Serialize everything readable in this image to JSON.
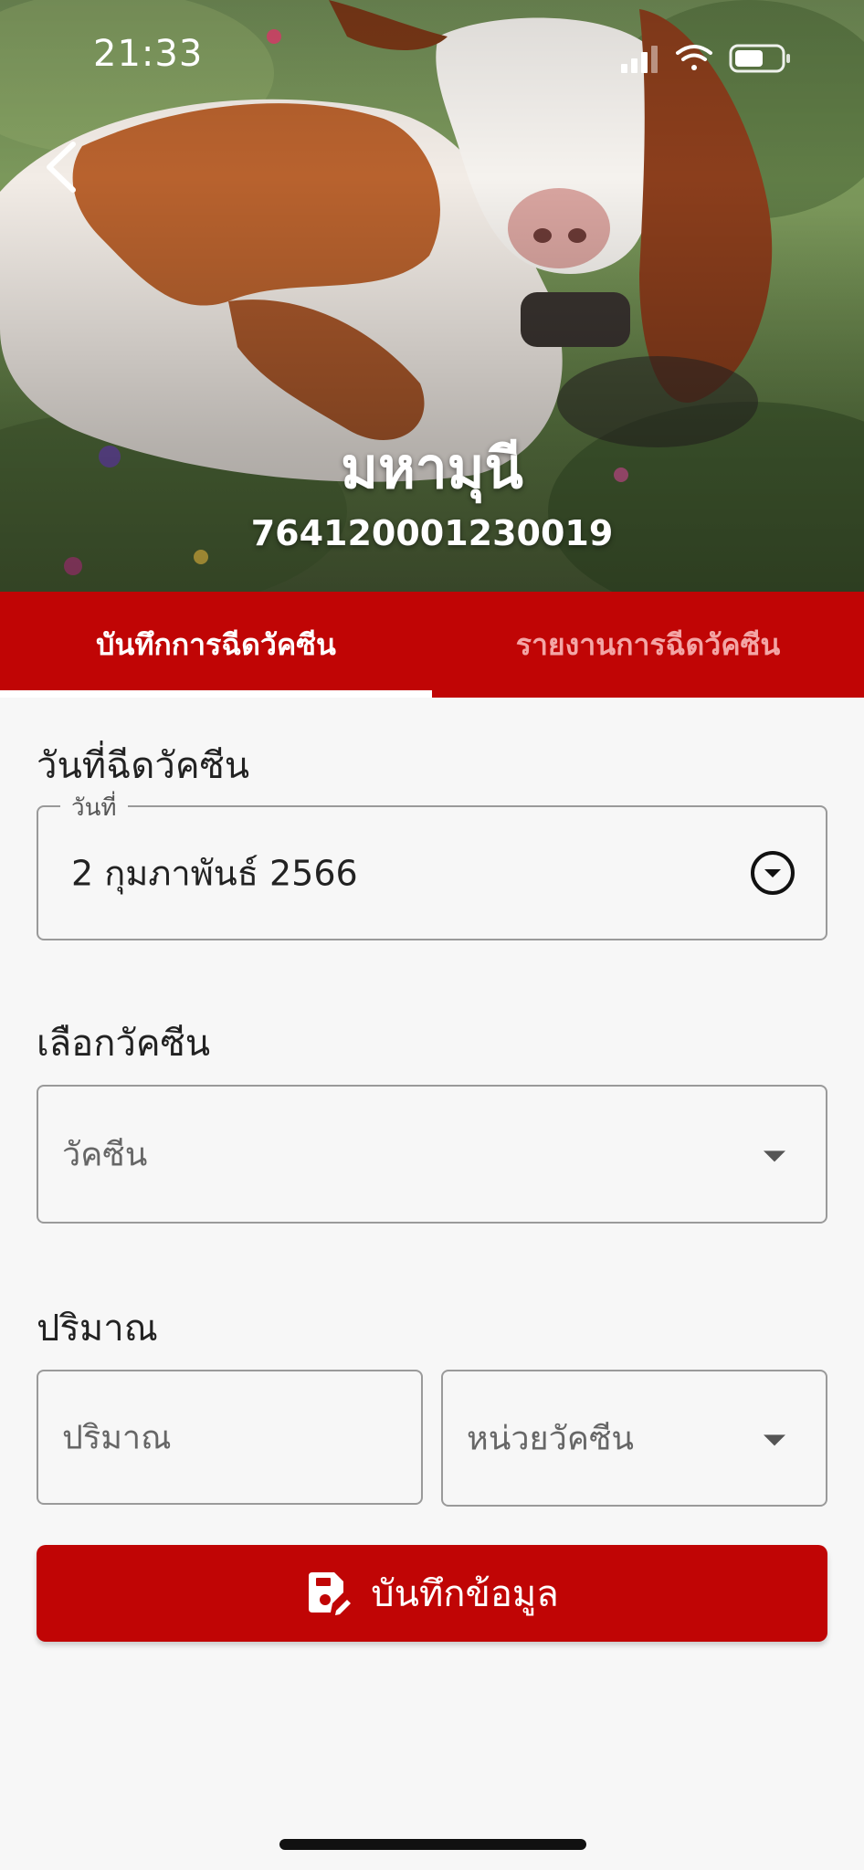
{
  "status_bar": {
    "time": "21:33"
  },
  "header": {
    "animal_name": "มหามุนี",
    "animal_id": "764120001230019"
  },
  "tabs": [
    {
      "label": "บันทึกการฉีดวัคซีน",
      "active": true
    },
    {
      "label": "รายงานการฉีดวัคซีน",
      "active": false
    }
  ],
  "form": {
    "date_section_label": "วันที่ฉีดวัคซีน",
    "date_legend": "วันที่",
    "date_value": "2 กุมภาพันธ์ 2566",
    "vaccine_section_label": "เลือกวัคซีน",
    "vaccine_placeholder": "วัคซีน",
    "amount_section_label": "ปริมาณ",
    "amount_placeholder": "ปริมาณ",
    "unit_placeholder": "หน่วยวัคซีน"
  },
  "actions": {
    "save_label": "บันทึกข้อมูล"
  },
  "colors": {
    "brand_red": "#c00505",
    "inactive_tab_text": "#f3a5a5",
    "background": "#f7f7f7"
  }
}
